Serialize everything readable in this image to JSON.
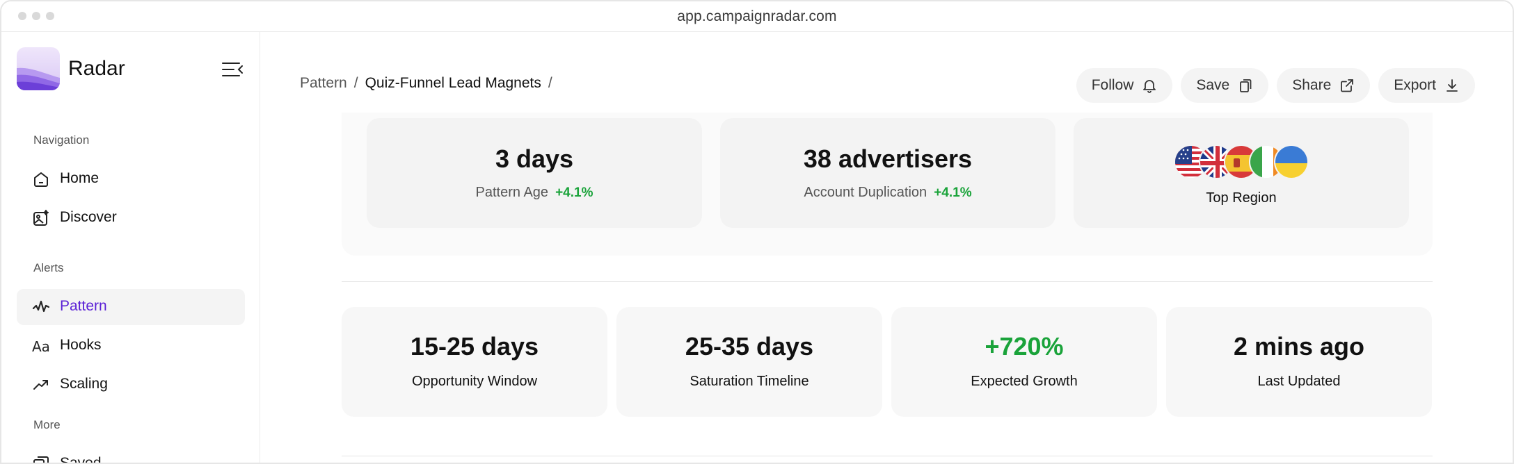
{
  "window": {
    "url": "app.campaignradar.com"
  },
  "sidebar": {
    "brand": "Radar",
    "sections": [
      {
        "label": "Navigation",
        "items": [
          {
            "label": "Home",
            "icon": "home-icon"
          },
          {
            "label": "Discover",
            "icon": "discover-icon"
          }
        ]
      },
      {
        "label": "Alerts",
        "items": [
          {
            "label": "Pattern",
            "icon": "pattern-icon",
            "active": true
          },
          {
            "label": "Hooks",
            "icon": "hooks-icon"
          },
          {
            "label": "Scaling",
            "icon": "scaling-icon"
          }
        ]
      },
      {
        "label": "More",
        "items": [
          {
            "label": "Saved",
            "icon": "saved-icon"
          }
        ]
      }
    ],
    "accent_color": "#5b21d6"
  },
  "breadcrumb": {
    "root": "Pattern",
    "current": "Quiz-Funnel Lead Magnets",
    "sep": "/"
  },
  "actions": [
    {
      "label": "Follow",
      "icon": "bell-icon"
    },
    {
      "label": "Save",
      "icon": "bookmark-icon"
    },
    {
      "label": "Share",
      "icon": "external-link-icon"
    },
    {
      "label": "Export",
      "icon": "download-icon"
    }
  ],
  "top_stats": {
    "age": {
      "value": "3 days",
      "label": "Pattern Age",
      "change": "+4.1%"
    },
    "duplication": {
      "value": "38 advertisers",
      "label": "Account Duplication",
      "change": "+4.1%"
    },
    "region": {
      "label": "Top Region",
      "flags": [
        "us-flag-icon",
        "uk-flag-icon",
        "spain-flag-icon",
        "ireland-flag-icon",
        "ukraine-flag-icon"
      ]
    }
  },
  "stats": [
    {
      "value": "15-25 days",
      "label": "Opportunity Window"
    },
    {
      "value": "25-35 days",
      "label": "Saturation Timeline"
    },
    {
      "value": "+720%",
      "label": "Expected Growth",
      "positive": true
    },
    {
      "value": "2 mins ago",
      "label": "Last Updated"
    }
  ],
  "colors": {
    "positive": "#1aa33a"
  }
}
